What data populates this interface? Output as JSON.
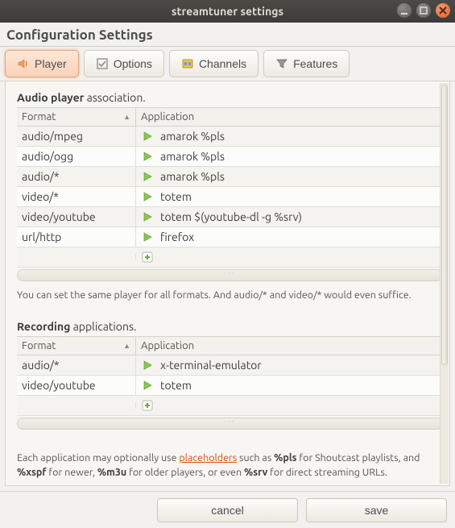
{
  "window": {
    "title": "streamtuner settings"
  },
  "heading": "Configuration Settings",
  "tabs": {
    "player": "Player",
    "options": "Options",
    "channels": "Channels",
    "features": "Features",
    "active": "player"
  },
  "sections": {
    "audio": {
      "title_bold": "Audio player",
      "title_rest": " association.",
      "headers": {
        "format": "Format",
        "application": "Application"
      },
      "rows": [
        {
          "format": "audio/mpeg",
          "app": "amarok %pls",
          "icon": "play"
        },
        {
          "format": "audio/ogg",
          "app": "amarok %pls",
          "icon": "play"
        },
        {
          "format": "audio/*",
          "app": "amarok %pls",
          "icon": "play"
        },
        {
          "format": "video/*",
          "app": "totem",
          "icon": "play"
        },
        {
          "format": "video/youtube",
          "app": "totem $(youtube-dl -g %srv)",
          "icon": "play"
        },
        {
          "format": "url/http",
          "app": "firefox",
          "icon": "play"
        }
      ],
      "hint": "You can set the same player for all formats. And audio/* and video/* would even suffice."
    },
    "recording": {
      "title_bold": "Recording",
      "title_rest": " applications.",
      "headers": {
        "format": "Format",
        "application": "Application"
      },
      "rows": [
        {
          "format": "audio/*",
          "app": "x-terminal-emulator",
          "icon": "play"
        },
        {
          "format": "video/youtube",
          "app": "   totem",
          "icon": "play"
        }
      ],
      "hint_pre": "Each application may optionally use ",
      "hint_link": "placeholders",
      "hint_mid1": " such as ",
      "hint_b1": "%pls",
      "hint_mid2": " for Shoutcast playlists, and ",
      "hint_b2": "%xspf",
      "hint_mid3": " for newer, ",
      "hint_b3": "%m3u",
      "hint_mid4": " for older players, or even ",
      "hint_b4": "%srv",
      "hint_end": " for direct streaming URLs."
    }
  },
  "buttons": {
    "cancel": "cancel",
    "save": "save"
  },
  "icons": {
    "speaker": "speaker-icon",
    "checkbox": "checkbox-icon",
    "channels": "channels-icon",
    "features": "funnel-icon",
    "play": "play-icon",
    "add": "add-icon"
  }
}
